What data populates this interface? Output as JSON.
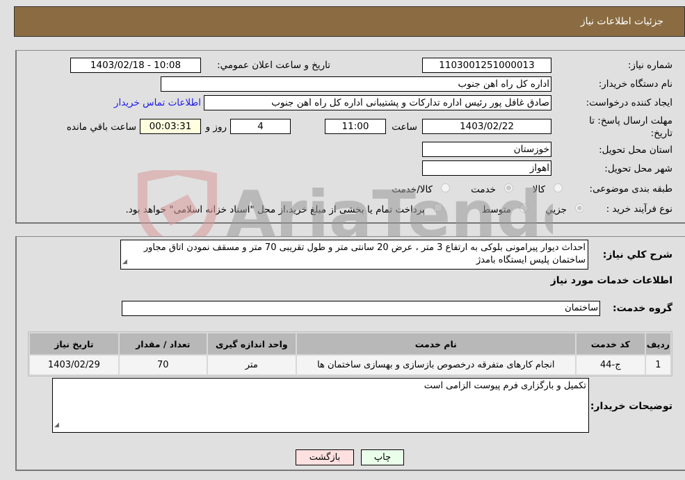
{
  "header": {
    "title": "جزئیات اطلاعات نیاز"
  },
  "fields": {
    "need_number": {
      "label": "شماره نیاز:",
      "value": "1103001251000013"
    },
    "announce_datetime": {
      "label": "تاریخ و ساعت اعلان عمومي:",
      "value": "1403/02/18 - 10:08"
    },
    "buyer_org": {
      "label": "نام دستگاه خریدار:",
      "value": "اداره کل راه اهن جنوب"
    },
    "requester": {
      "label": "ایجاد کننده درخواست:",
      "value": "صادق غافل پور رئیس اداره تدارکات و پشتیبانی اداره کل راه اهن جنوب",
      "contact_link": "اطلاعات تماس خریدار"
    },
    "deadline": {
      "label": "مهلت ارسال پاسخ: تا تاریخ:",
      "date": "1403/02/22",
      "time_label": "ساعت",
      "time": "11:00",
      "days": "4",
      "days_label": "روز و",
      "remaining": "00:03:31",
      "remaining_label": "ساعت باقي مانده"
    },
    "province": {
      "label": "استان محل تحویل:",
      "value": "خوزستان"
    },
    "city": {
      "label": "شهر محل تحویل:",
      "value": "اهواز"
    },
    "category": {
      "label": "طبقه بندی موضوعی:",
      "options": [
        "کالا",
        "خدمت",
        "کالا/خدمت"
      ],
      "selected": "خدمت"
    },
    "process": {
      "label": "نوع فرآیند خرید :",
      "options": [
        "جزيي",
        "متوسط"
      ],
      "selected": "جزيي",
      "treasury_note": "پرداخت تمام یا بخشی از مبلغ خرید،از محل \"اسناد خزانه اسلامی\" خواهد بود."
    }
  },
  "description": {
    "label": "شرح کلي نیاز:",
    "value": "احداث دیوار پیرامونی بلوکی به ارتفاع 3 متر ، عرض 20 سانتی متر و طول تقریبی 70 متر و مسقف نمودن اتاق مجاور ساختمان پلیس ایستگاه بامدژ"
  },
  "services_section": {
    "title": "اطلاعات خدمات مورد نیاز"
  },
  "service_group": {
    "label": "گروه خدمت:",
    "value": "ساختمان"
  },
  "table": {
    "headers": [
      "ردیف",
      "کد خدمت",
      "نام خدمت",
      "واحد اندازه گیری",
      "تعداد / مقدار",
      "تاریخ نیاز"
    ],
    "rows": [
      [
        "1",
        "ج-44",
        "انجام کارهای متفرقه درخصوص بازسازی و بهسازی ساختمان ها",
        "متر",
        "70",
        "1403/02/29"
      ]
    ]
  },
  "buyer_notes": {
    "label": "توضیحات خریدار:",
    "value": "تکمیل و بارگزاری فرم پیوست الزامی است"
  },
  "buttons": {
    "print": "چاپ",
    "back": "بازگشت"
  },
  "watermark": {
    "text": "AriaTender.neT"
  }
}
